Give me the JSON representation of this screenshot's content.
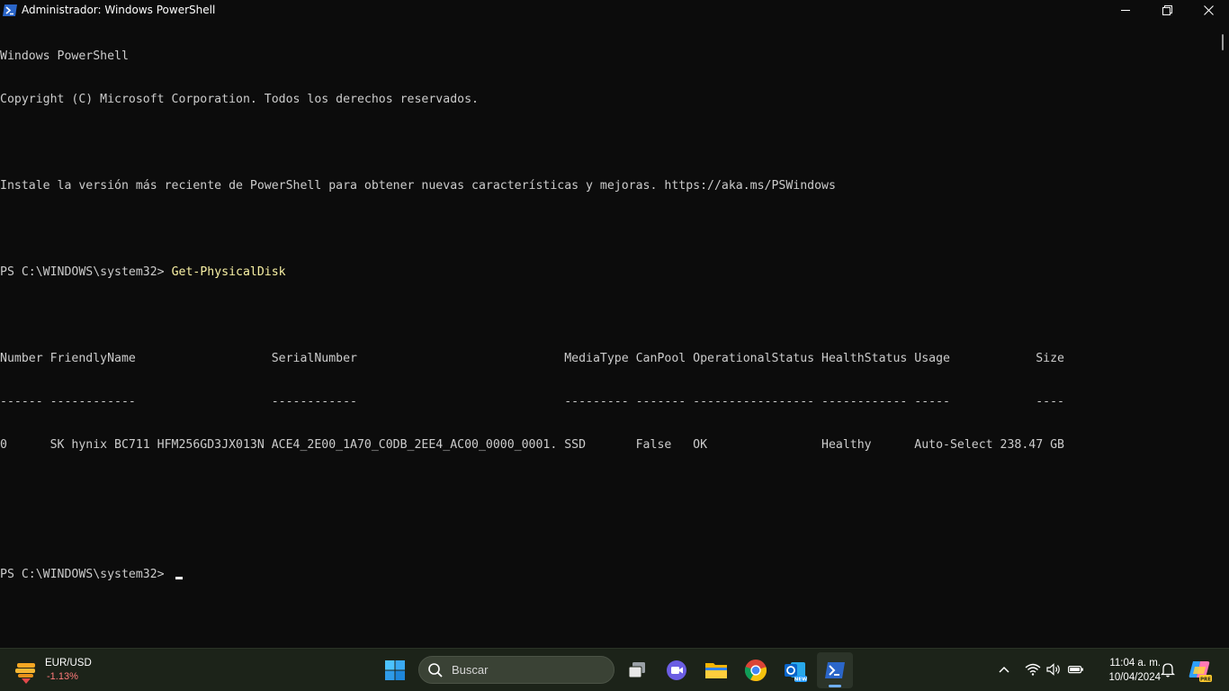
{
  "window": {
    "title": "Administrador: Windows PowerShell",
    "icon": "powershell-icon",
    "controls": [
      "minimize-icon",
      "restore-icon",
      "close-icon"
    ]
  },
  "console": {
    "banner_1": "Windows PowerShell",
    "banner_2": "Copyright (C) Microsoft Corporation. Todos los derechos reservados.",
    "banner_3": "Instale la versión más reciente de PowerShell para obtener nuevas características y mejoras. https://aka.ms/PSWindows",
    "prompt_1": "PS C:\\WINDOWS\\system32> ",
    "command_1": "Get-PhysicalDisk",
    "table_header": "Number FriendlyName                   SerialNumber                             MediaType CanPool OperationalStatus HealthStatus Usage            Size",
    "table_separator": "------ ------------                   ------------                             --------- ------- ----------------- ------------ -----            ----",
    "table_rows": [
      "0      SK hynix BC711 HFM256GD3JX013N ACE4_2E00_1A70_C0DB_2EE4_AC00_0000_0001. SSD       False   OK                Healthy      Auto-Select 238.47 GB"
    ],
    "prompt_2": "PS C:\\WINDOWS\\system32> ",
    "text_color": "#cccccc",
    "command_color": "#f9f1a5",
    "background": "#0c0c0c"
  },
  "taskbar": {
    "widget": {
      "title": "EUR/USD",
      "value": "-1.13%",
      "icon": "stock-ticker-icon"
    },
    "search": {
      "placeholder": "Buscar"
    },
    "apps": [
      "start-icon",
      "task-view-icon",
      "teams-meet-icon",
      "file-explorer-icon",
      "chrome-icon",
      "outlook-new-icon",
      "powershell-icon"
    ],
    "active_app": "powershell-icon",
    "tray": [
      "chevron-up-icon",
      "wifi-icon",
      "volume-icon",
      "battery-icon"
    ],
    "clock": {
      "time": "11:04 a. m.",
      "date": "10/04/2024"
    },
    "notification_icon": "bell-icon",
    "copilot_icon": "copilot-pre-icon",
    "background": "#1c2319"
  }
}
